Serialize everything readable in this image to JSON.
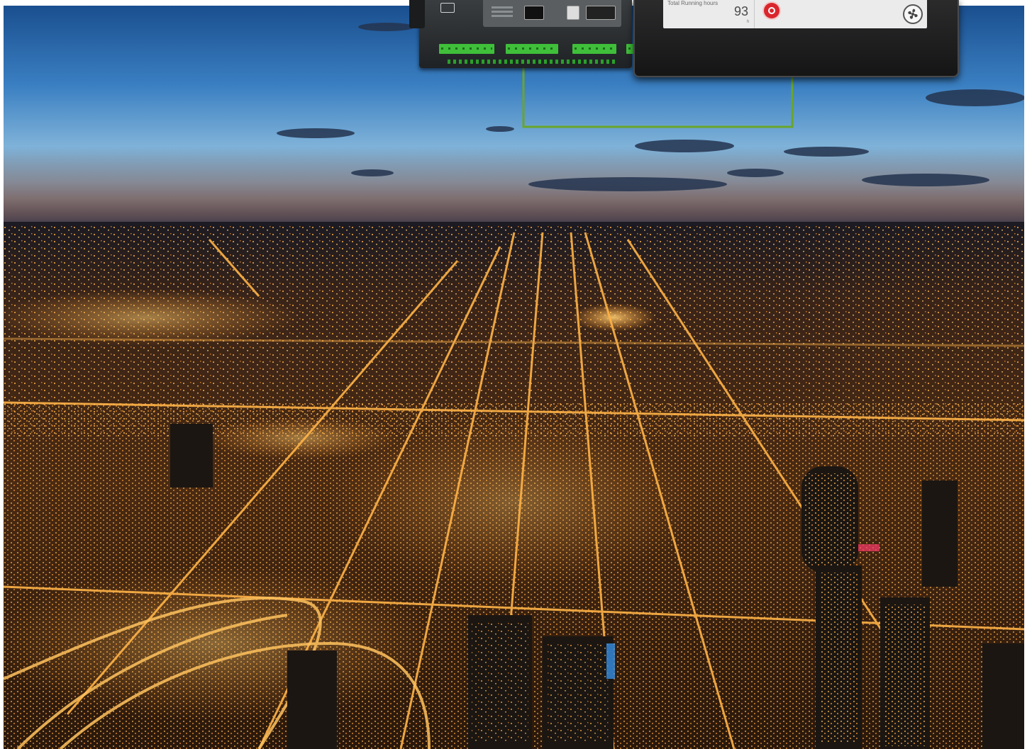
{
  "hmi": {
    "metric_label": "Total Running hours",
    "metric_value": "93",
    "metric_unit": "h",
    "stop_icon": "stop-icon",
    "fan_icon": "fan-icon"
  },
  "colors": {
    "cable_green": "#6aa52a",
    "terminal_green": "#3fbf3a",
    "sky_top": "#1f5fa3",
    "city_glow": "#f39a2a"
  }
}
